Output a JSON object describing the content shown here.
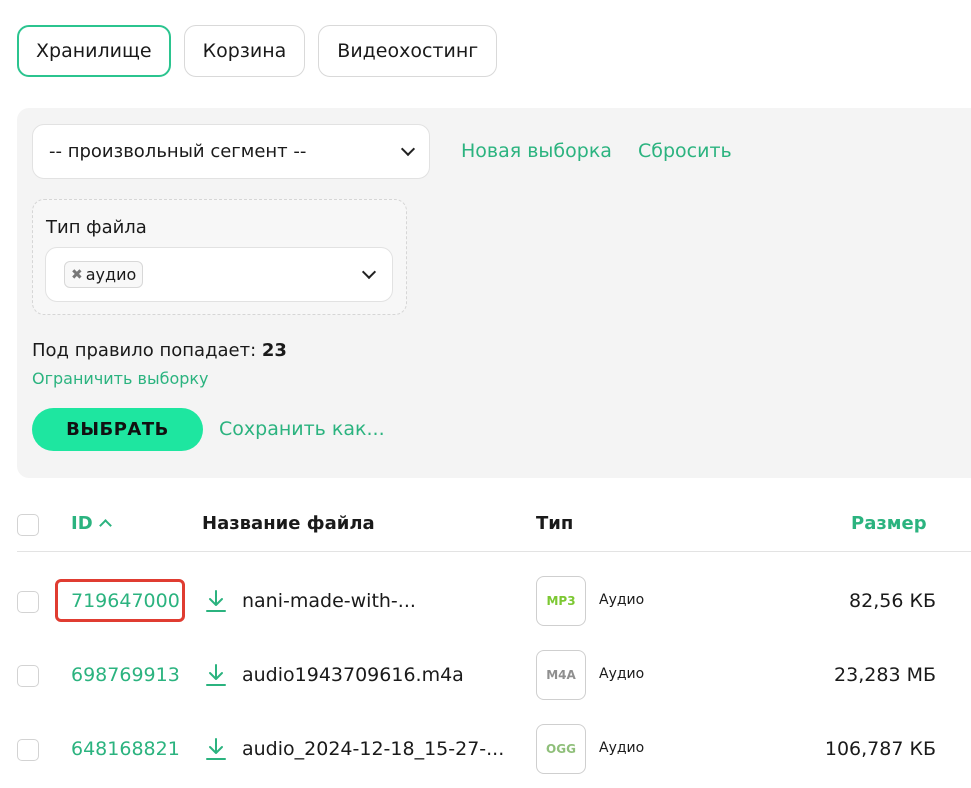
{
  "tabs": [
    {
      "label": "Хранилище",
      "active": true
    },
    {
      "label": "Корзина",
      "active": false
    },
    {
      "label": "Видеохостинг",
      "active": false
    }
  ],
  "filter": {
    "segment_value": "-- произвольный сегмент --",
    "new_selection": "Новая выборка",
    "reset": "Сбросить",
    "file_type_title": "Тип файла",
    "file_type_chip": "аудио",
    "count_label": "Под правило попадает:",
    "count_value": "23",
    "limit_link": "Ограничить выборку",
    "select_button": "ВЫБРАТЬ",
    "save_as": "Сохранить как..."
  },
  "table": {
    "headers": {
      "id": "ID",
      "name": "Название файла",
      "type": "Тип",
      "size": "Размер"
    },
    "rows": [
      {
        "id": "719647000",
        "name": "nani-made-with-...",
        "badge": "MP3",
        "badge_color": "#7cc832",
        "type": "Аудио",
        "size": "82,56 КБ",
        "highlighted": true
      },
      {
        "id": "698769913",
        "name": "audio1943709616.m4a",
        "badge": "M4A",
        "badge_color": "#8f8f8f",
        "type": "Аудио",
        "size": "23,283 МБ",
        "highlighted": false
      },
      {
        "id": "648168821",
        "name": "audio_2024-12-18_15-27-...",
        "badge": "OGG",
        "badge_color": "#8fbf7a",
        "type": "Аудио",
        "size": "106,787 КБ",
        "highlighted": false
      }
    ]
  },
  "colors": {
    "accent": "#2bb37f",
    "button": "#1ee6a0",
    "highlight": "#e03c31"
  }
}
